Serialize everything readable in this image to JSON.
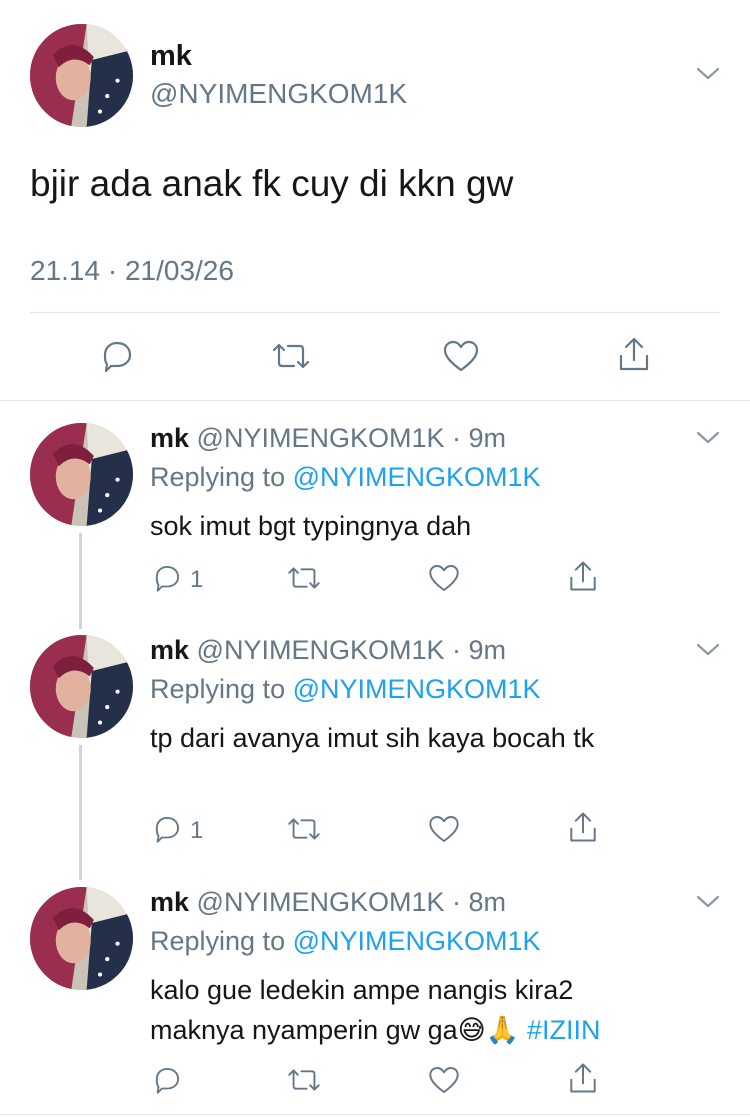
{
  "main_tweet": {
    "name": "mk",
    "handle": "@NYIMENGKOM1K",
    "text": "bjir ada anak fk cuy di kkn gw",
    "timestamp": "21.14 · 21/03/26"
  },
  "replies": [
    {
      "name": "mk",
      "handle": "@NYIMENGKOM1K",
      "time": "· 9m",
      "replying_prefix": "Replying to",
      "replying_handle": "@NYIMENGKOM1K",
      "text_line1": "sok imut bgt typingnya dah",
      "text_line2": "",
      "reply_count": "1"
    },
    {
      "name": "mk",
      "handle": "@NYIMENGKOM1K",
      "time": "· 9m",
      "replying_prefix": "Replying to",
      "replying_handle": "@NYIMENGKOM1K",
      "text_line1": "tp dari avanya imut sih kaya bocah tk",
      "text_line2": "",
      "reply_count": "1"
    },
    {
      "name": "mk",
      "handle": "@NYIMENGKOM1K",
      "time": "· 8m",
      "replying_prefix": "Replying to",
      "replying_handle": "@NYIMENGKOM1K",
      "text_line1": "kalo gue ledekin ampe nangis kira2",
      "text_line2": "maknya nyamperin gw ga",
      "emoji": "😅🙏",
      "hashtag": "#IZIIN",
      "reply_count": ""
    }
  ],
  "icons": [
    "reply-icon",
    "retweet-icon",
    "like-icon",
    "share-icon",
    "chevron-down-icon"
  ],
  "colors": {
    "link": "#1da1f2",
    "muted": "#657786",
    "text": "#14171a",
    "divider": "#e1e8ed"
  }
}
